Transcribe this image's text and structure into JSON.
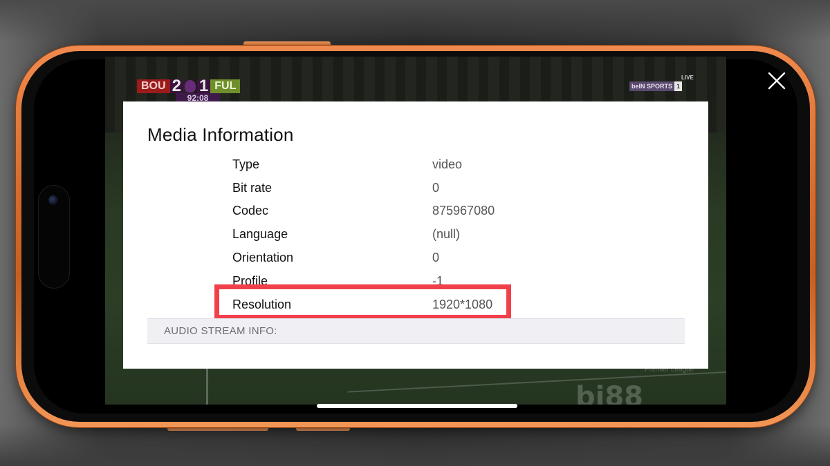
{
  "video": {
    "scoreboard": {
      "home_team": "BOU",
      "home_score": "2",
      "away_score": "1",
      "away_team": "FUL",
      "clock": "92:08"
    },
    "broadcaster": {
      "live_label": "LIVE",
      "name": "beIN SPORTS",
      "channel": "1"
    },
    "ad_text": "bi88",
    "ad_small_text": "Premier League"
  },
  "dialog": {
    "title": "Media Information",
    "rows": [
      {
        "label": "Type",
        "value": "video"
      },
      {
        "label": "Bit rate",
        "value": "0"
      },
      {
        "label": "Codec",
        "value": "875967080"
      },
      {
        "label": "Language",
        "value": "(null)"
      },
      {
        "label": "Orientation",
        "value": "0"
      },
      {
        "label": "Profile",
        "value": "-1"
      },
      {
        "label": "Resolution",
        "value": "1920*1080"
      }
    ],
    "section_header": "AUDIO STREAM INFO:",
    "highlight_row": "Resolution",
    "highlight_color": "#f2404a"
  },
  "controls": {
    "close_icon": "close-icon"
  },
  "device": {
    "frame_color": "#d56a2c"
  }
}
